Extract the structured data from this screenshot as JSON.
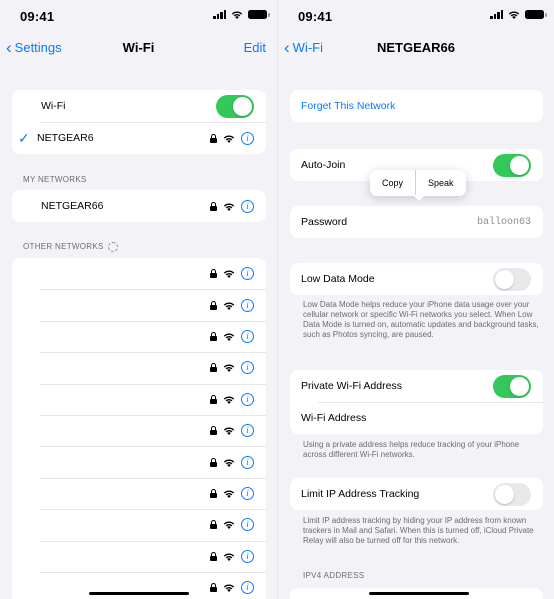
{
  "left": {
    "status": {
      "time": "09:41"
    },
    "nav": {
      "back_label": "Settings",
      "title": "Wi-Fi",
      "edit_label": "Edit"
    },
    "wifi_toggle": {
      "label": "Wi-Fi",
      "on": true
    },
    "connected_network": {
      "name": "NETGEAR6"
    },
    "my_networks": {
      "header": "MY NETWORKS",
      "items": [
        {
          "name": "NETGEAR66"
        }
      ]
    },
    "other_networks": {
      "header": "OTHER NETWORKS",
      "row_count": 11
    }
  },
  "right": {
    "status": {
      "time": "09:41"
    },
    "nav": {
      "back_label": "Wi-Fi",
      "title": "NETGEAR66"
    },
    "forget_label": "Forget This Network",
    "auto_join": {
      "label": "Auto-Join",
      "on": true
    },
    "popup": {
      "copy": "Copy",
      "speak": "Speak"
    },
    "password": {
      "label": "Password",
      "value": "balloon63"
    },
    "low_data": {
      "label": "Low Data Mode",
      "on": false,
      "footer": "Low Data Mode helps reduce your iPhone data usage over your cellular network or specific Wi-Fi networks you select. When Low Data Mode is turned on, automatic updates and background tasks, such as Photos syncing, are paused."
    },
    "private_address": {
      "label": "Private Wi-Fi Address",
      "on": true,
      "sub_label": "Wi-Fi Address",
      "footer": "Using a private address helps reduce tracking of your iPhone across different Wi-Fi networks."
    },
    "limit_ip": {
      "label": "Limit IP Address Tracking",
      "on": false,
      "footer": "Limit IP address tracking by hiding your IP address from known trackers in Mail and Safari. When this is turned off, iCloud Private Relay will also be turned off for this network."
    },
    "ipv4_header": "IPV4 ADDRESS"
  },
  "colors": {
    "accent": "#0a7aff",
    "toggle_on": "#34c759",
    "background": "#f2f2f7"
  }
}
